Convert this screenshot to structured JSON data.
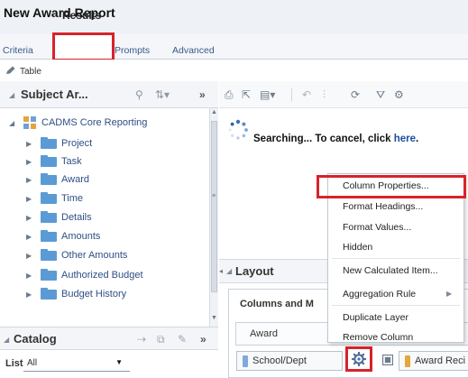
{
  "page": {
    "title": "New Award Report"
  },
  "tabs": [
    {
      "label": "Criteria"
    },
    {
      "label": "Results"
    },
    {
      "label": "Prompts"
    },
    {
      "label": "Advanced"
    }
  ],
  "view": {
    "label": "Table"
  },
  "subject_areas": {
    "title": "Subject Ar...",
    "root": "CADMS Core Reporting",
    "folders": [
      "Project",
      "Task",
      "Award",
      "Time",
      "Details",
      "Amounts",
      "Other Amounts",
      "Authorized Budget",
      "Budget History"
    ]
  },
  "catalog": {
    "title": "Catalog",
    "list_label": "List",
    "list_value": "All"
  },
  "compound": {
    "searching": "Searching...",
    "cancel_prefix": " To cancel, click ",
    "cancel_link": "here",
    "cancel_suffix": "."
  },
  "layout": {
    "title": "Layout",
    "columns_title": "Columns and M",
    "section": "Award",
    "columns": [
      "School/Dept",
      "Award Reci"
    ]
  },
  "context_menu": {
    "items": [
      {
        "label": "Column Properties..."
      },
      {
        "label": "Format Headings..."
      },
      {
        "label": "Format Values..."
      },
      {
        "label": "Hidden"
      },
      {
        "label": "New Calculated Item..."
      },
      {
        "label": "Aggregation Rule"
      },
      {
        "label": "Duplicate Layer"
      },
      {
        "label": "Remove Column"
      }
    ]
  },
  "colors": {
    "highlight": "#d8232a",
    "folder": "#5b9bd5",
    "link": "#2e4f84"
  },
  "icons": [
    "pencil-icon",
    "magnifier-icon",
    "sort-icon",
    "expand-icon",
    "cube-icon",
    "folder-icon",
    "print-icon",
    "export-icon",
    "gear-icon",
    "spinner-icon",
    "grid-icon",
    "submenu-arrow-icon"
  ]
}
